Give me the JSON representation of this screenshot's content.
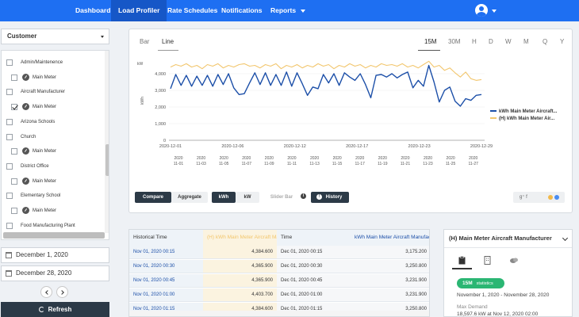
{
  "nav": {
    "items": [
      "Dashboard",
      "Load Profiler",
      "Rate Schedules",
      "Notifications",
      "Reports"
    ],
    "active": "Load Profiler"
  },
  "sidebar": {
    "customer_select": "Customer",
    "tree": [
      {
        "label": "Admin/Maintenence",
        "type": "group",
        "checked": false
      },
      {
        "label": "Main Meter",
        "type": "meter",
        "checked": false
      },
      {
        "label": "Aircraft Manufacturer",
        "type": "group",
        "checked": false
      },
      {
        "label": "Main Meter",
        "type": "meter",
        "checked": true
      },
      {
        "label": "Arizona Schools",
        "type": "group",
        "checked": false
      },
      {
        "label": "Church",
        "type": "group",
        "checked": false
      },
      {
        "label": "Main Meter",
        "type": "meter",
        "checked": false
      },
      {
        "label": "District Office",
        "type": "group",
        "checked": false
      },
      {
        "label": "Main Meter",
        "type": "meter",
        "checked": false
      },
      {
        "label": "Elementary School",
        "type": "group",
        "checked": false
      },
      {
        "label": "Main Meter",
        "type": "meter",
        "checked": false
      },
      {
        "label": "Food Manufacturing Plant",
        "type": "group",
        "checked": false
      }
    ],
    "start_date": "December 1, 2020",
    "end_date": "December 28, 2020",
    "refresh_label": "Refresh"
  },
  "chart_panel": {
    "tabs": [
      "Bar",
      "Line"
    ],
    "active_tab": "Line",
    "periods": [
      "15M",
      "30M",
      "H",
      "D",
      "W",
      "M",
      "Q",
      "Y"
    ],
    "active_period": "15M",
    "buttons": {
      "compare": "Compare",
      "aggregate": "Aggregate",
      "kwh": "kWh",
      "kw": "kW",
      "slider_bar": "Slider Bar",
      "history": "History"
    },
    "share": {
      "google": "g⁺ f"
    },
    "colors": {
      "primary": "#1c4fa8",
      "history": "#f2c66d",
      "accent": "#1e6ff2"
    }
  },
  "chart_data": {
    "type": "line",
    "ylabel": "kWh",
    "yunit": "kW",
    "ylim": [
      0,
      5000
    ],
    "yticks": [
      "0",
      "1,000",
      "2,000",
      "3,000",
      "4,000"
    ],
    "x_top_ticks": [
      "2020-12-01",
      "2020-12-06",
      "2020-12-12",
      "2020-12-17",
      "2020-12-23",
      "2020-12-29"
    ],
    "x_bottom_ticks": [
      "2020-11-01",
      "2020-11-03",
      "2020-11-05",
      "2020-11-07",
      "2020-11-09",
      "2020-11-11",
      "2020-11-13",
      "2020-11-15",
      "2020-11-17",
      "2020-11-19",
      "2020-11-21",
      "2020-11-23",
      "2020-11-25",
      "2020-11-27"
    ],
    "series": [
      {
        "name": "kWh Main Meter Aircraft...",
        "color": "#1c4fa8",
        "values": [
          3100,
          3950,
          3300,
          3900,
          3250,
          3850,
          3300,
          3900,
          3250,
          3950,
          3350,
          4000,
          3150,
          2750,
          2800,
          3450,
          4050,
          3350,
          4050,
          3300,
          3950,
          3300,
          4100,
          3250,
          4050,
          3400,
          2700,
          3200,
          3100,
          3950,
          3450,
          4000,
          3300,
          4050,
          3800,
          3600,
          4000,
          3350,
          2550,
          3900,
          3950,
          3800,
          4000,
          3750,
          3950,
          4100,
          3150,
          3600,
          3250,
          4500,
          3500,
          2300,
          3000,
          3200,
          2350,
          2050,
          2500,
          2400,
          2700,
          2750
        ]
      },
      {
        "name": "(H) kWh Main Meter Air...",
        "color": "#f2c66d",
        "values": [
          4400,
          4550,
          4450,
          4600,
          4400,
          4500,
          4300,
          4550,
          4450,
          4600,
          4350,
          4500,
          4400,
          4550,
          4600,
          4450,
          4500,
          4350,
          4550,
          4450,
          4600,
          4300,
          4500,
          4400,
          4550,
          4350,
          4500,
          4400,
          4600,
          4450,
          4550,
          4300,
          4500,
          4400,
          4600,
          4450,
          4550,
          4350,
          4500,
          4400,
          4600,
          4500,
          4550,
          4450,
          4600,
          4400,
          4500,
          4350,
          4550,
          4750,
          4400,
          4500,
          4200,
          4350,
          4050,
          3800,
          4100,
          3700,
          3600,
          3650
        ]
      }
    ]
  },
  "table": {
    "headers": [
      "Historical Time",
      "(H) kWh Main Meter Aircraft Ma...",
      "Time",
      "kWh Main Meter Aircraft Manufact..."
    ],
    "rows": [
      [
        "Nov 01, 2020 00:15",
        "4,384.600",
        "Dec 01, 2020 00:15",
        "3,175.200"
      ],
      [
        "Nov 01, 2020 00:30",
        "4,365.900",
        "Dec 01, 2020 00:30",
        "3,250.800"
      ],
      [
        "Nov 01, 2020 00:45",
        "4,365.900",
        "Dec 01, 2020 00:45",
        "3,231.900"
      ],
      [
        "Nov 01, 2020 01:00",
        "4,403.700",
        "Dec 01, 2020 01:00",
        "3,231.900"
      ],
      [
        "Nov 01, 2020 01:15",
        "4,384.600",
        "Dec 01, 2020 01:15",
        "3,250.800"
      ]
    ]
  },
  "details": {
    "title": "(H) Main Meter Aircraft Manufacturer",
    "badge_main": "15M",
    "badge_sub": "statistics",
    "range": "November 1, 2020 - November 28, 2020",
    "max_label": "Max Demand",
    "max_value": "18,597.6 kW at Nov 12, 2020 02:00"
  }
}
